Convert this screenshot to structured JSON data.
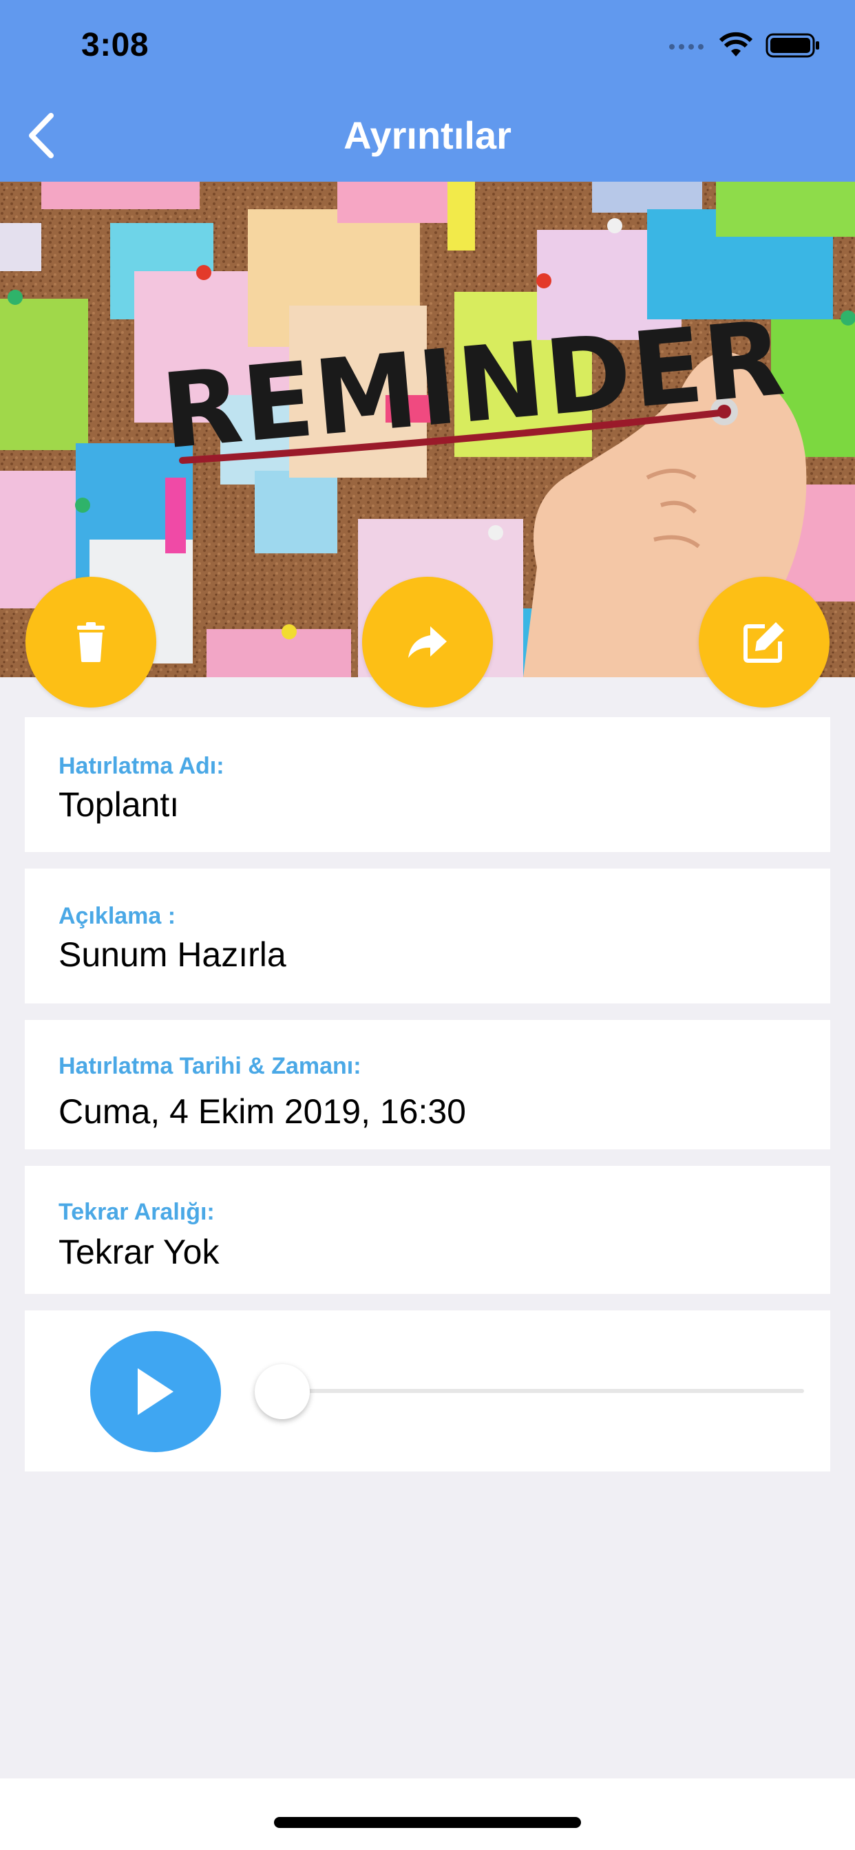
{
  "status_bar": {
    "time": "3:08"
  },
  "nav": {
    "title": "Ayrıntılar",
    "back_icon": "chevron-left-icon"
  },
  "hero_image": {
    "text": "REMINDER"
  },
  "actions": {
    "delete_icon": "trash-icon",
    "share_icon": "share-forward-icon",
    "edit_icon": "edit-icon"
  },
  "fields": [
    {
      "label": "Hatırlatma Adı:",
      "value": "Toplantı"
    },
    {
      "label": "Açıklama :",
      "value": "Sunum Hazırla"
    },
    {
      "label": "Hatırlatma Tarihi & Zamanı:",
      "value": "Cuma, 4 Ekim 2019, 16:30"
    },
    {
      "label": "Tekrar Aralığı:",
      "value": "Tekrar Yok"
    }
  ],
  "audio_player": {
    "play_icon": "play-icon",
    "progress": 0
  },
  "colors": {
    "header": "#6199ee",
    "accent": "#fdbf15",
    "label": "#4aa8e6",
    "play": "#3fa6f2",
    "background": "#f0eff4"
  }
}
